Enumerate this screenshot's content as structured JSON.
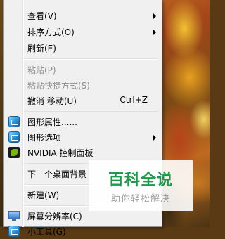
{
  "context_menu": {
    "items": [
      {
        "label": "查看(V)",
        "submenu": true
      },
      {
        "label": "排序方式(O)",
        "submenu": true
      },
      {
        "label": "刷新(E)"
      },
      {
        "label": "粘贴(P)",
        "disabled": true
      },
      {
        "label": "粘贴快捷方式(S)",
        "disabled": true
      },
      {
        "label": "撤消 移动(U)",
        "shortcut": "Ctrl+Z"
      },
      {
        "label": "图形属性......",
        "icon": "graphics-properties-icon"
      },
      {
        "label": "图形选项",
        "icon": "graphics-options-icon",
        "submenu": true
      },
      {
        "label": "NVIDIA 控制面板",
        "icon": "nvidia-icon"
      },
      {
        "label": "下一个桌面背景"
      },
      {
        "label": "新建(W)",
        "submenu": true
      },
      {
        "label": "屏幕分辨率(C)",
        "icon": "screen-resolution-icon"
      },
      {
        "label": "小工具(G)",
        "icon": "gadgets-icon"
      }
    ]
  },
  "watermark": {
    "title": "百科全说",
    "subtitle": "助你轻松解决"
  },
  "colors": {
    "menu_bg": "#f0f0f0",
    "disabled_text": "#8d8d8d",
    "watermark_green": "#1a9a4a"
  }
}
